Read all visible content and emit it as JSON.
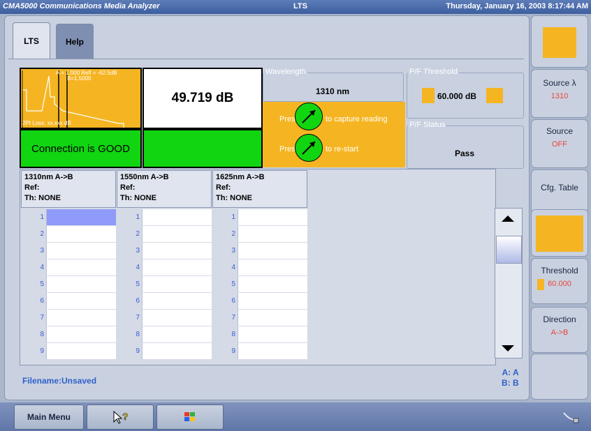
{
  "window": {
    "app_title": "CMA5000 Communications Media Analyzer",
    "mode_title": "LTS",
    "datetime": "Thursday, January 16, 2003 8:17:44 AM"
  },
  "tabs": [
    {
      "label": "LTS",
      "active": true
    },
    {
      "label": "Help",
      "active": false
    }
  ],
  "trace": {
    "a_refl_label": "A = 1.000  Refl = -62.5dB",
    "b_label": "B=1.5000",
    "loss_label": "2Pt Loss: xx.xxx dB"
  },
  "reading": {
    "loss_value": "49.719 dB",
    "connection_status": "Connection is GOOD"
  },
  "wavelength": {
    "group_label": "Wavelength",
    "value": "1310 nm"
  },
  "press_panel": {
    "press1": "Press",
    "action1": "to capture reading",
    "press2": "Press",
    "action2": "to re-start"
  },
  "pf_threshold": {
    "group_label": "P/F Threshold",
    "value": "60.000 dB"
  },
  "pf_status": {
    "group_label": "P/F Status",
    "value": "Pass"
  },
  "table": {
    "columns": [
      {
        "title": "1310nm A->B",
        "ref": "Ref:",
        "th": "Th: NONE"
      },
      {
        "title": "1550nm A->B",
        "ref": "Ref:",
        "th": "Th: NONE"
      },
      {
        "title": "1625nm A->B",
        "ref": "Ref:",
        "th": "Th: NONE"
      }
    ],
    "row_numbers": [
      "1",
      "2",
      "3",
      "4",
      "5",
      "6",
      "7",
      "8",
      "9"
    ]
  },
  "footer": {
    "filename": "Filename:Unsaved",
    "a_label": "A: A",
    "b_label": "B: B"
  },
  "softkeys": {
    "source_lambda_label": "Source λ",
    "source_lambda_value": "1310",
    "source_label": "Source",
    "source_value": "OFF",
    "cfg_table_label": "Cfg. Table",
    "threshold_label": "Threshold",
    "threshold_value": "60.000",
    "direction_label": "Direction",
    "direction_value": "A->B"
  },
  "bottom": {
    "main_menu_label": "Main Menu"
  },
  "colors": {
    "accent_yellow": "#f5b522",
    "status_green": "#11d511",
    "selected_cell": "#8f9bf8",
    "value_red": "#e8443a",
    "link_blue": "#2f5fc9"
  }
}
